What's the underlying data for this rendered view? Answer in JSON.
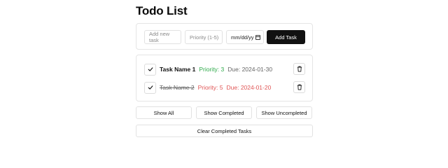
{
  "page": {
    "title": "Todo List"
  },
  "form": {
    "task_placeholder": "Add new task",
    "priority_placeholder": "Priority (1-5)",
    "date_placeholder": "mm/dd/yy",
    "add_label": "Add Task",
    "calendar_icon": "calendar-icon"
  },
  "tasks": [
    {
      "name": "Task Name 1",
      "priority": "Priority: 3",
      "due": "Due: 2024-01-30",
      "completed": false,
      "priority_color": "#2eaa4a",
      "due_color": "#666666"
    },
    {
      "name": "Task Name 2",
      "priority": "Priority: 5",
      "due": "Due: 2024-01-20",
      "completed": true,
      "priority_color": "#e05555",
      "due_color": "#e05555"
    }
  ],
  "filters": {
    "all": "Show All",
    "completed": "Show Completed",
    "uncompleted": "Show Uncompleted"
  },
  "clear_label": "Clear Completed Tasks",
  "colors": {
    "accent": "#111111",
    "border": "#e5e5e5"
  }
}
